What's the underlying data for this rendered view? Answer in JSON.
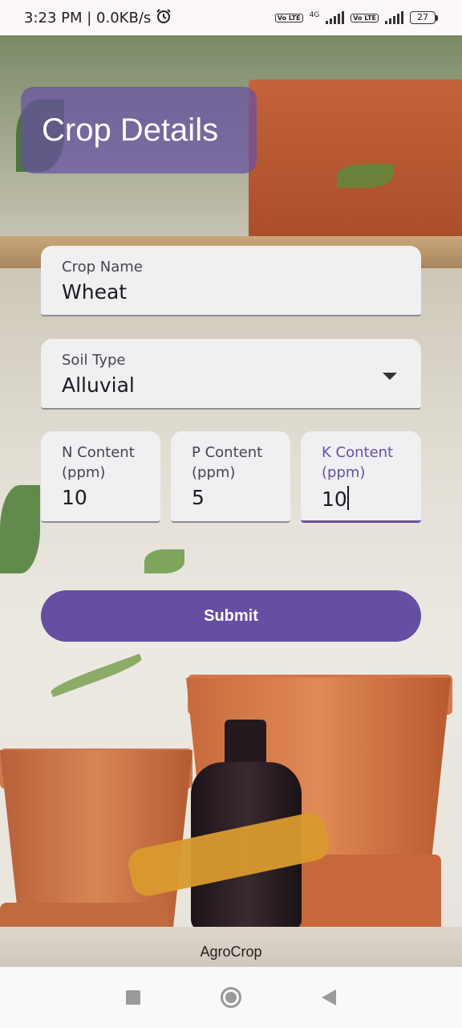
{
  "status_bar": {
    "time_and_speed": "3:23 PM | 0.0KB/s",
    "network_1": "4G",
    "volte_label": "Vo LTE",
    "battery": "27"
  },
  "title": "Crop Details",
  "form": {
    "crop_name": {
      "label": "Crop Name",
      "value": "Wheat"
    },
    "soil_type": {
      "label": "Soil Type",
      "value": "Alluvial"
    },
    "n_content": {
      "label": "N Content (ppm)",
      "value": "10"
    },
    "p_content": {
      "label": "P Content (ppm)",
      "value": "5"
    },
    "k_content": {
      "label": "K Content (ppm)",
      "value": "10"
    }
  },
  "submit_label": "Submit",
  "footer": "AgroCrop",
  "colors": {
    "accent": "#6750a4",
    "title_bg": "#6750a4"
  },
  "icons": {
    "alarm": "alarm-icon",
    "recents": "recents-square-icon",
    "home": "home-circle-icon",
    "back": "back-triangle-icon"
  }
}
